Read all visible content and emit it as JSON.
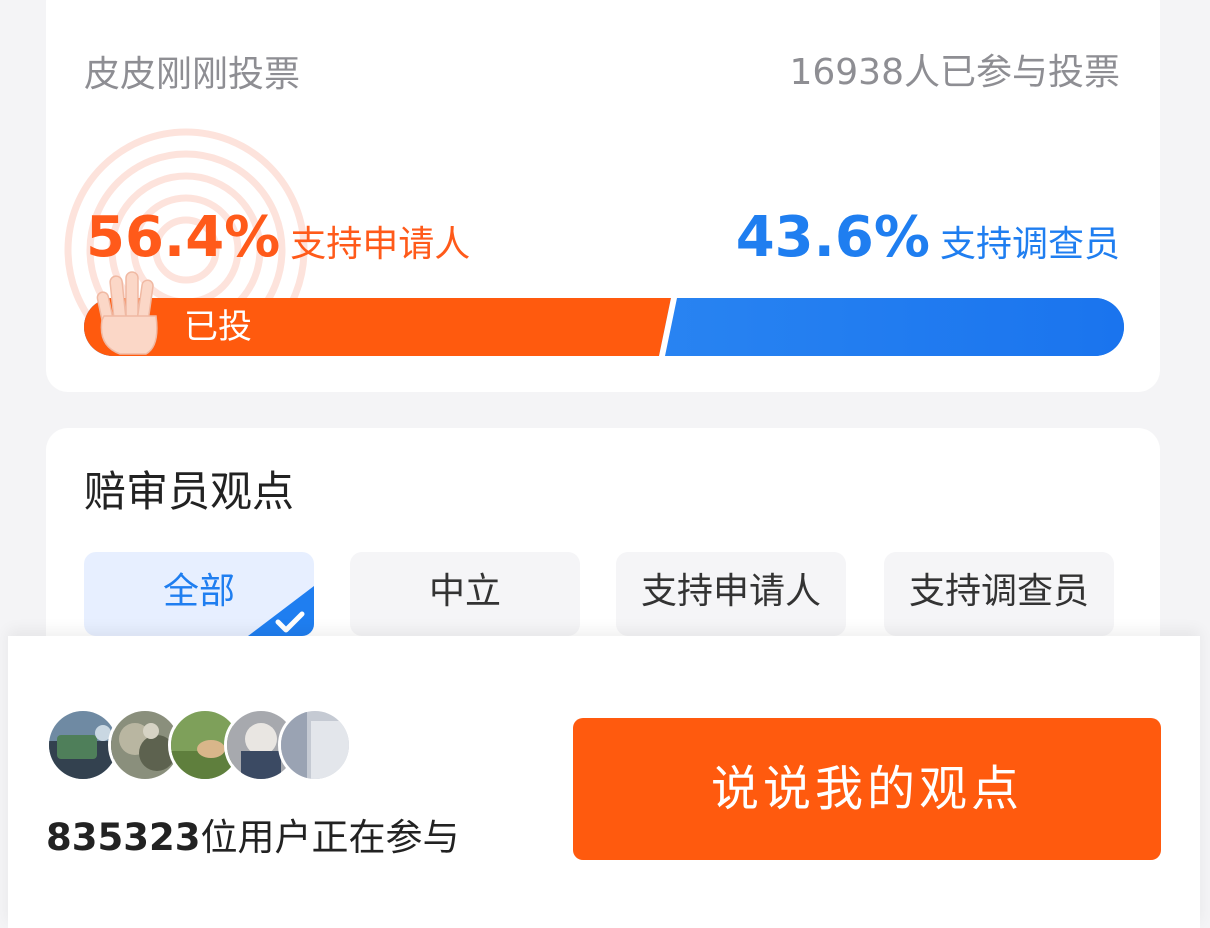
{
  "vote": {
    "title": "皮皮刚刚投票",
    "participant_count": "16938人已参与投票",
    "applicant": {
      "percent": "56.4%",
      "percent_value": 56.4,
      "label": "支持申请人",
      "color": "#ff5a1a"
    },
    "investigator": {
      "percent": "43.6%",
      "percent_value": 43.6,
      "label": "支持调查员",
      "color": "#1f7ef0"
    },
    "voted_label": "已投"
  },
  "opinions": {
    "title": "赔审员观点",
    "tabs": [
      {
        "label": "全部",
        "active": true
      },
      {
        "label": "中立",
        "active": false
      },
      {
        "label": "支持申请人",
        "active": false
      },
      {
        "label": "支持调查员",
        "active": false
      }
    ]
  },
  "bottom": {
    "participant_number": "835323",
    "participant_suffix": "位用户正在参与",
    "cta_label": "说说我的观点",
    "cta_color": "#ff5a0e"
  }
}
